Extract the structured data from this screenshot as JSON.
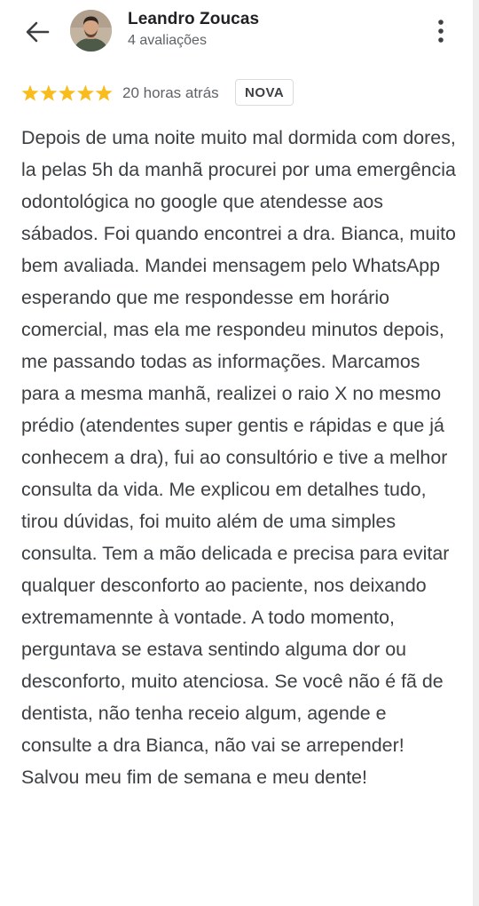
{
  "reviewer": {
    "name": "Leandro Zoucas",
    "review_count": "4 avaliações"
  },
  "review": {
    "rating": 5,
    "max_rating": 5,
    "time_ago": "20 horas atrás",
    "badge": "NOVA",
    "text": "Depois de uma noite muito mal dormida com dores, la pelas 5h da manhã procurei por uma emergência odontológica no google que atendesse aos sábados. Foi quando encontrei a dra. Bianca, muito bem avaliada. Mandei mensagem pelo WhatsApp esperando que me respondesse em horário comercial, mas ela me respondeu minutos depois, me passando todas as informações. Marcamos para a mesma manhã, realizei o raio X no mesmo prédio (atendentes super gentis e rápidas e que já conhecem a dra), fui ao consultório e tive a melhor consulta da vida. Me explicou em detalhes tudo, tirou dúvidas, foi muito além de uma simples consulta. Tem a mão delicada e precisa para evitar qualquer desconforto ao paciente, nos deixando extremamennte à vontade. A todo momento, perguntava se estava sentindo alguma dor ou desconforto, muito atenciosa. Se você não é fã de dentista, não tenha receio algum, agende e consulte a dra Bianca, não vai se arrepender! Salvou meu fim de semana e meu dente!"
  },
  "icons": {
    "back": "arrow-back-icon",
    "menu": "more-vert-icon",
    "star": "star-icon"
  },
  "colors": {
    "star": "#f9bc1d",
    "text_primary": "#202124",
    "text_secondary": "#5f6368"
  }
}
